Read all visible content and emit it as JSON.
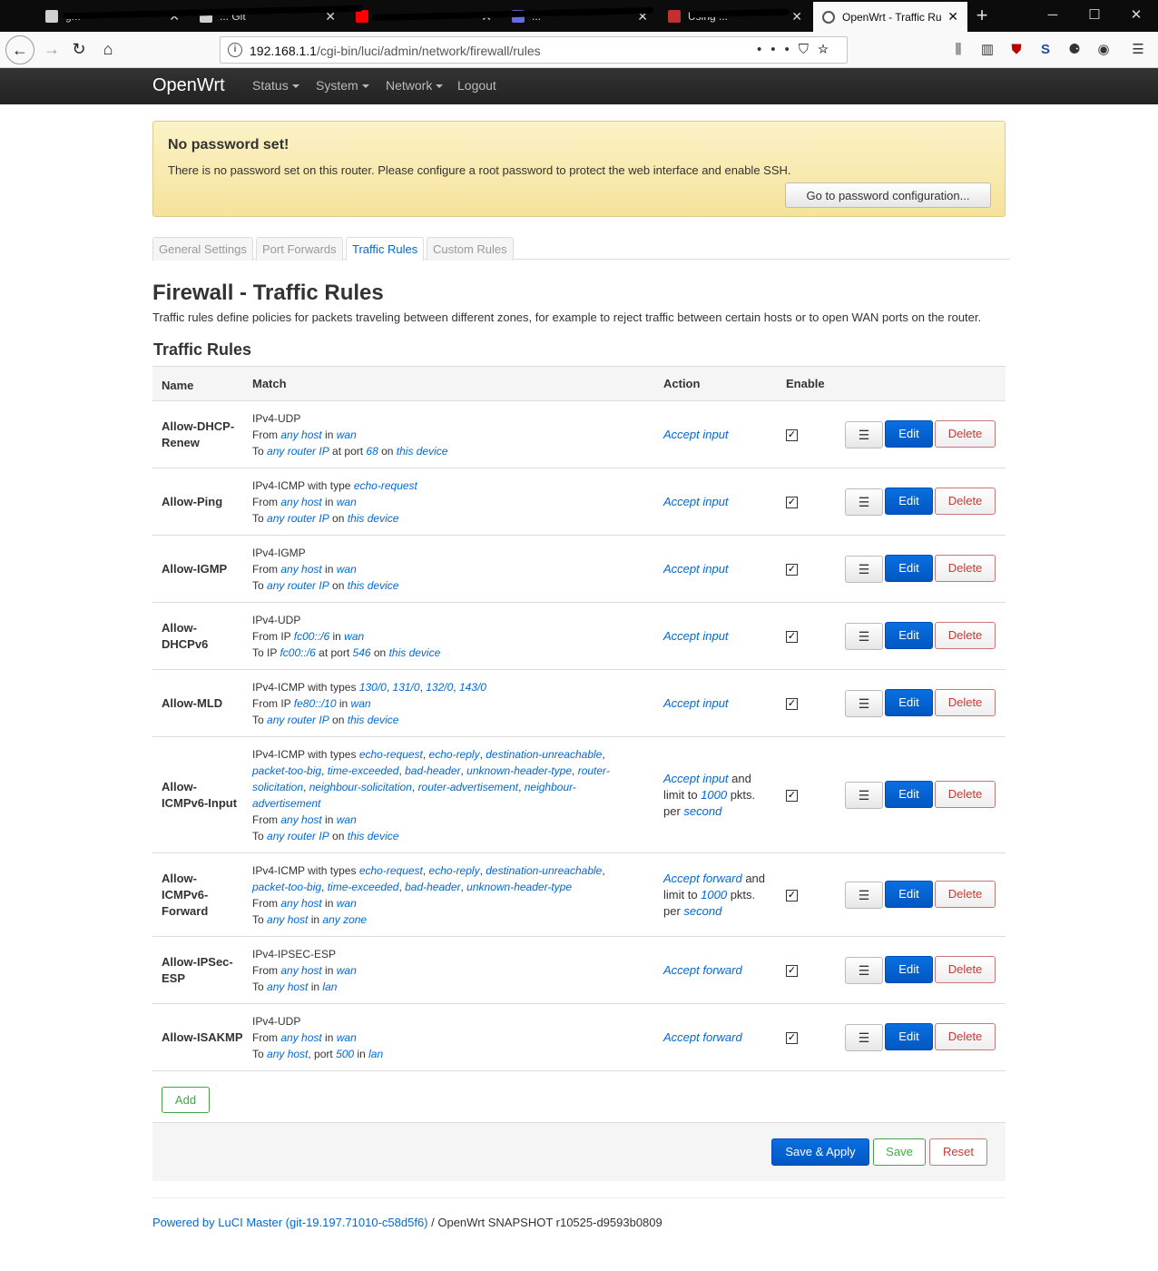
{
  "browser": {
    "tabs": [
      {
        "title": "g...",
        "fav_color": "#d0d0d0"
      },
      {
        "title": "... Git",
        "fav_color": "#d0d0d0"
      },
      {
        "title": "...",
        "fav_color": "#ff0000"
      },
      {
        "title": "...",
        "fav_color": "#6a6ae0"
      },
      {
        "title": "Using ...",
        "fav_color": "#c03030"
      },
      {
        "title": "OpenWrt - Traffic Ru",
        "fav_color": "#888888"
      }
    ],
    "url_host": "192.168.1.1",
    "url_path": "/cgi-bin/luci/admin/network/firewall/rules"
  },
  "header": {
    "brand": "OpenWrt",
    "menu": [
      "Status",
      "System",
      "Network",
      "Logout"
    ]
  },
  "alert": {
    "title": "No password set!",
    "text": "There is no password set on this router. Please configure a root password to protect the web interface and enable SSH.",
    "button": "Go to password configuration..."
  },
  "tabs": [
    "General Settings",
    "Port Forwards",
    "Traffic Rules",
    "Custom Rules"
  ],
  "page": {
    "title": "Firewall - Traffic Rules",
    "description": "Traffic rules define policies for packets traveling between different zones, for example to reject traffic between certain hosts or to open WAN ports on the router.",
    "section_title": "Traffic Rules"
  },
  "table": {
    "headers": {
      "name": "Name",
      "match": "Match",
      "action": "Action",
      "enable": "Enable"
    },
    "buttons": {
      "sort": "☰",
      "edit": "Edit",
      "delete": "Delete"
    },
    "rows": [
      {
        "name": "Allow-DHCP-Renew",
        "enabled": true,
        "match": "IPv4-UDP<br>From <i>any host</i> in <i>wan</i><br>To <i>any router IP</i> at port <i>68</i> on <i>this device</i>",
        "action": "<i>Accept input</i>"
      },
      {
        "name": "Allow-Ping",
        "enabled": true,
        "match": "IPv4-ICMP with type <i>echo-request</i><br>From <i>any host</i> in <i>wan</i><br>To <i>any router IP</i> on <i>this device</i>",
        "action": "<i>Accept input</i>"
      },
      {
        "name": "Allow-IGMP",
        "enabled": true,
        "match": "IPv4-IGMP<br>From <i>any host</i> in <i>wan</i><br>To <i>any router IP</i> on <i>this device</i>",
        "action": "<i>Accept input</i>"
      },
      {
        "name": "Allow-DHCPv6",
        "enabled": true,
        "match": "IPv4-UDP<br>From IP <i>fc00::/6</i> in <i>wan</i><br>To IP <i>fc00::/6</i> at port <i>546</i> on <i>this device</i>",
        "action": "<i>Accept input</i>"
      },
      {
        "name": "Allow-MLD",
        "enabled": true,
        "match": "IPv4-ICMP with types <i>130/0</i>, <i>131/0</i>, <i>132/0</i>, <i>143/0</i><br>From IP <i>fe80::/10</i> in <i>wan</i><br>To <i>any router IP</i> on <i>this device</i>",
        "action": "<i>Accept input</i>"
      },
      {
        "name": "Allow-ICMPv6-Input",
        "enabled": true,
        "match": "IPv4-ICMP with types <i>echo-request</i>, <i>echo-reply</i>, <i>destination-unreachable</i>, <i>packet-too-big</i>, <i>time-exceeded</i>, <i>bad-header</i>, <i>unknown-header-type</i>, <i>router-solicitation</i>, <i>neighbour-solicitation</i>, <i>router-advertisement</i>, <i>neighbour-advertisement</i><br>From <i>any host</i> in <i>wan</i><br>To <i>any router IP</i> on <i>this device</i>",
        "action": "<i>Accept input</i> and limit to <i>1000</i> pkts. per <i>second</i>"
      },
      {
        "name": "Allow-ICMPv6-Forward",
        "enabled": true,
        "match": "IPv4-ICMP with types <i>echo-request</i>, <i>echo-reply</i>, <i>destination-unreachable</i>, <i>packet-too-big</i>, <i>time-exceeded</i>, <i>bad-header</i>, <i>unknown-header-type</i><br>From <i>any host</i> in <i>wan</i><br>To <i>any host</i> in <i>any zone</i>",
        "action": "<i>Accept forward</i> and limit to <i>1000</i> pkts. per <i>second</i>"
      },
      {
        "name": "Allow-IPSec-ESP",
        "enabled": true,
        "match": "IPv4-IPSEC-ESP<br>From <i>any host</i> in <i>wan</i><br>To <i>any host</i> in <i>lan</i>",
        "action": "<i>Accept forward</i>"
      },
      {
        "name": "Allow-ISAKMP",
        "enabled": true,
        "match": "IPv4-UDP<br>From <i>any host</i> in <i>wan</i><br>To <i>any host</i>, port <i>500</i> in <i>lan</i>",
        "action": "<i>Accept forward</i>"
      }
    ]
  },
  "actions": {
    "add": "Add",
    "save_apply": "Save & Apply",
    "save": "Save",
    "reset": "Reset"
  },
  "footer": {
    "powered_link": "Powered by LuCI Master (git-19.197.71010-c58d5f6)",
    "version": " / OpenWrt SNAPSHOT r10525-d9593b0809"
  }
}
